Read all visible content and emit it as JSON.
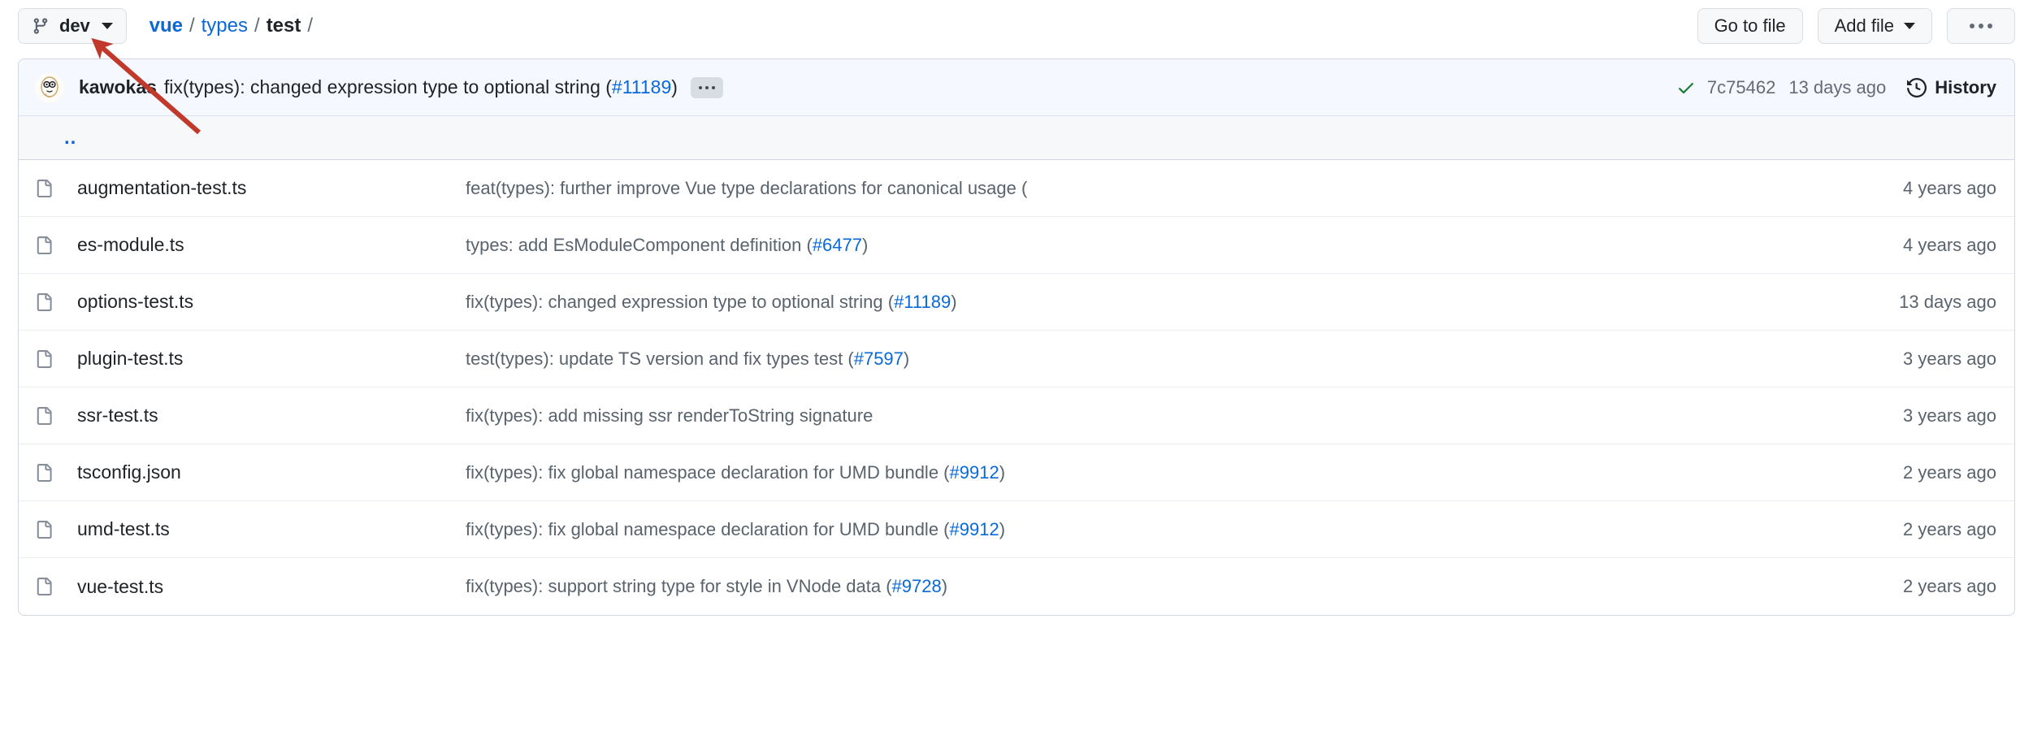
{
  "header": {
    "branch": {
      "icon": "git-branch-icon",
      "name": "dev",
      "caret": "chevron-down-icon"
    },
    "breadcrumb": {
      "repo": "vue",
      "sep": "/",
      "parts": [
        "types"
      ],
      "current": "test",
      "trailing": "/"
    },
    "actions": {
      "go_to_file": "Go to file",
      "add_file": "Add file",
      "more": "more-options-icon"
    }
  },
  "commit_bar": {
    "avatar_alt": "kawokas",
    "author": "kawokas",
    "message_prefix": "fix(types): changed expression type to optional string (",
    "message_link": "#11189",
    "message_suffix": ")",
    "expand_label": "...",
    "status_icon": "check-icon",
    "sha": "7c75462",
    "age": "13 days ago",
    "history_label": "History",
    "history_icon": "history-icon"
  },
  "parent_row": {
    "label": "..",
    "name": "parent-directory"
  },
  "files": [
    {
      "icon": "file-icon",
      "name": "augmentation-test.ts",
      "message_prefix": "feat(types): further improve Vue type declarations for canonical usage (",
      "message_link": "",
      "message_suffix": "",
      "age": "4 years ago"
    },
    {
      "icon": "file-icon",
      "name": "es-module.ts",
      "message_prefix": "types: add EsModuleComponent definition (",
      "message_link": "#6477",
      "message_suffix": ")",
      "age": "4 years ago"
    },
    {
      "icon": "file-icon",
      "name": "options-test.ts",
      "message_prefix": "fix(types): changed expression type to optional string (",
      "message_link": "#11189",
      "message_suffix": ")",
      "age": "13 days ago"
    },
    {
      "icon": "file-icon",
      "name": "plugin-test.ts",
      "message_prefix": "test(types): update TS version and fix types test (",
      "message_link": "#7597",
      "message_suffix": ")",
      "age": "3 years ago"
    },
    {
      "icon": "file-icon",
      "name": "ssr-test.ts",
      "message_prefix": "fix(types): add missing ssr renderToString signature",
      "message_link": "",
      "message_suffix": "",
      "age": "3 years ago"
    },
    {
      "icon": "file-icon",
      "name": "tsconfig.json",
      "message_prefix": "fix(types): fix global namespace declaration for UMD bundle (",
      "message_link": "#9912",
      "message_suffix": ")",
      "age": "2 years ago"
    },
    {
      "icon": "file-icon",
      "name": "umd-test.ts",
      "message_prefix": "fix(types): fix global namespace declaration for UMD bundle (",
      "message_link": "#9912",
      "message_suffix": ")",
      "age": "2 years ago"
    },
    {
      "icon": "file-icon",
      "name": "vue-test.ts",
      "message_prefix": "fix(types): support string type for style in VNode data (",
      "message_link": "#9728",
      "message_suffix": ")",
      "age": "2 years ago"
    }
  ],
  "annotation": {
    "type": "arrow",
    "color": "#c0392b",
    "points_at": "branch-selector-button"
  },
  "colors": {
    "link": "#0969da",
    "text": "#1f2328",
    "muted": "#59636e",
    "border": "#d0d7de",
    "commit_bar_bg": "#f6f8ff",
    "button_bg": "#f6f8fa",
    "success": "#1a7f37",
    "annotation": "#c0392b"
  }
}
